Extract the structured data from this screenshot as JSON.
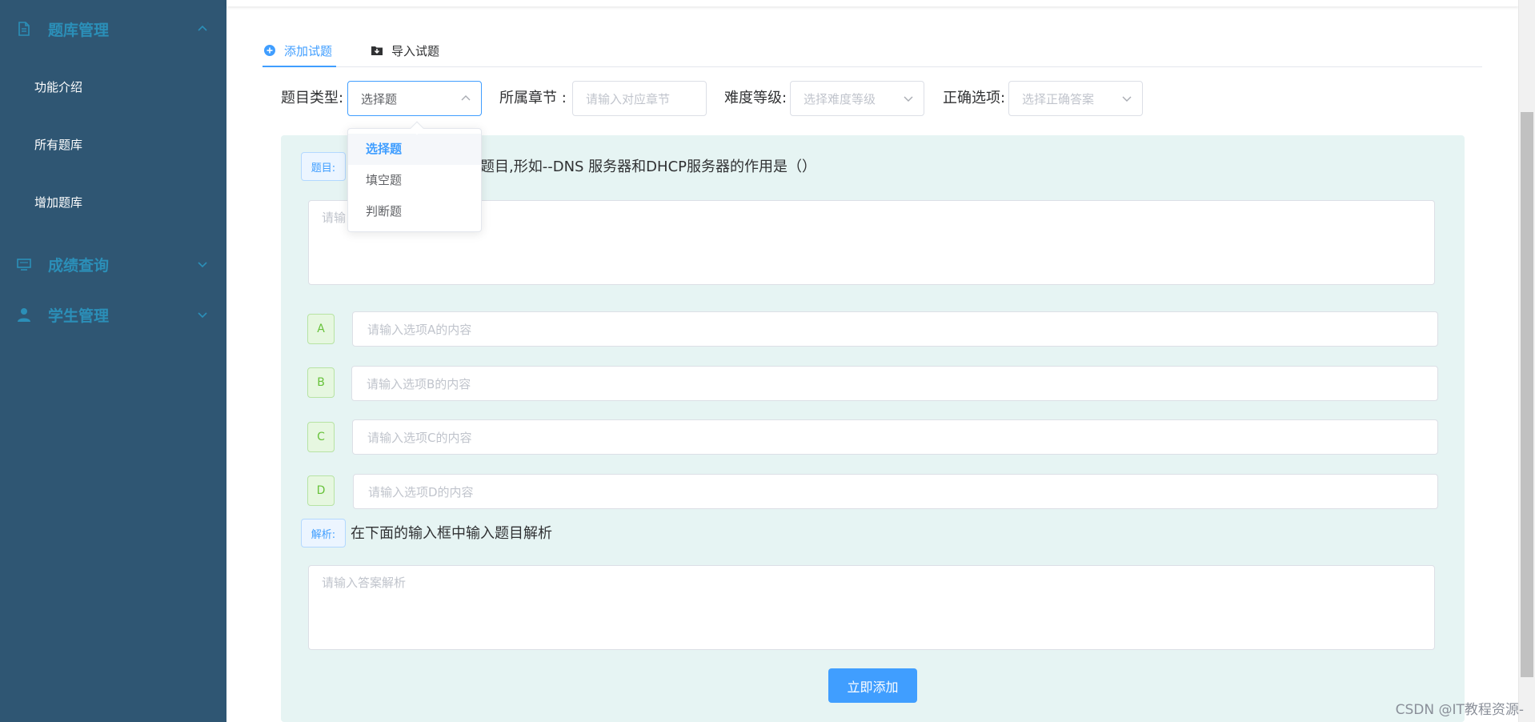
{
  "sidebar": {
    "groups": [
      {
        "label": "题库管理",
        "icon": "document-icon",
        "expanded": true
      },
      {
        "label": "成绩查询",
        "icon": "monitor-icon",
        "expanded": false
      },
      {
        "label": "学生管理",
        "icon": "user-icon",
        "expanded": false
      }
    ],
    "sub_items": [
      "功能介绍",
      "所有题库",
      "增加题库"
    ]
  },
  "tabs": [
    {
      "label": "添加试题",
      "icon": "plus-circle-icon",
      "active": true
    },
    {
      "label": "导入试题",
      "icon": "folder-download-icon",
      "active": false
    }
  ],
  "form": {
    "type_label": "题目类型:",
    "type_value": "选择题",
    "chapter_label": "所属章节 :",
    "chapter_placeholder": "请输入对应章节",
    "difficulty_label": "难度等级:",
    "difficulty_placeholder": "选择难度等级",
    "answer_label": "正确选项:",
    "answer_placeholder": "选择正确答案"
  },
  "dropdown": {
    "options": [
      "选择题",
      "填空题",
      "判断题"
    ],
    "selected_index": 0
  },
  "question": {
    "tag": "题目:",
    "hint_visible": "入题目,形如--DNS 服务器和DHCP服务器的作用是（）",
    "placeholder_visible": "请输"
  },
  "options": [
    {
      "letter": "A",
      "placeholder": "请输入选项A的内容"
    },
    {
      "letter": "B",
      "placeholder": "请输入选项B的内容"
    },
    {
      "letter": "C",
      "placeholder": "请输入选项C的内容"
    },
    {
      "letter": "D",
      "placeholder": "请输入选项D的内容"
    }
  ],
  "analysis": {
    "tag": "解析:",
    "hint": "在下面的输入框中输入题目解析",
    "placeholder": "请输入答案解析"
  },
  "submit_label": "立即添加",
  "watermark": "CSDN @IT教程资源-",
  "colors": {
    "sidebar_bg": "#2f5673",
    "sidebar_group_text": "#2b8fb8",
    "accent": "#409eff",
    "panel_bg": "#e6f4f3",
    "option_tag_bg": "#e6f7e0"
  }
}
